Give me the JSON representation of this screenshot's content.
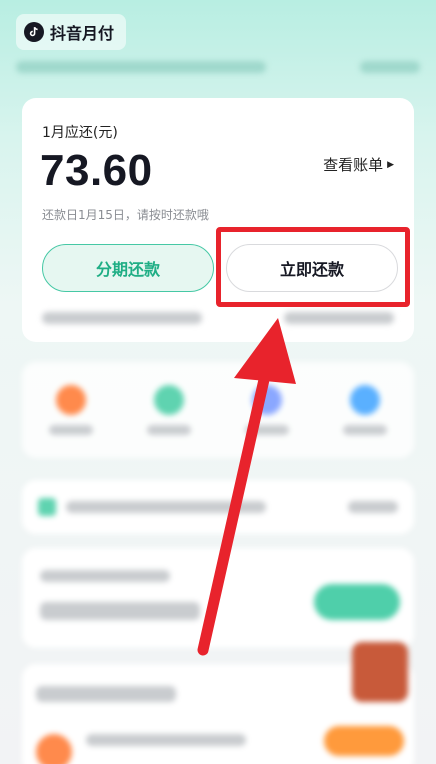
{
  "app": {
    "title": "抖音月付"
  },
  "colors": {
    "accent": "#1fae85",
    "highlight": "#e8232c"
  },
  "card": {
    "due_label": "1月应还(元)",
    "amount": "73.60",
    "view_bill": "查看账单",
    "due_note": "还款日1月15日，请按时还款哦",
    "install_button": "分期还款",
    "pay_button": "立即还款"
  },
  "icons": [
    "tiktok-logo-icon",
    "chevron-right-icon",
    "red-arrow-icon"
  ]
}
